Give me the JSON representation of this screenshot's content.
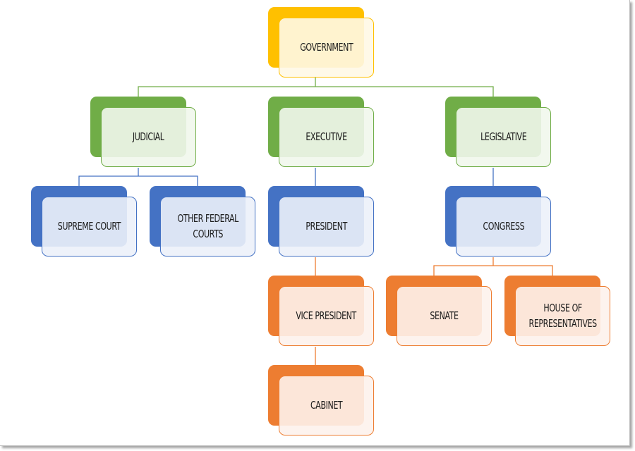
{
  "diagram": {
    "type": "org-chart",
    "colors": {
      "gold": "#FFC000",
      "gold_fill": "#FFF8E6",
      "green": "#70AD47",
      "green_fill": "#F1F7EC",
      "blue": "#4472C4",
      "blue_fill": "#ECF1FA",
      "orange": "#ED7D31",
      "orange_fill": "#FDF2EC"
    },
    "nodes": {
      "government": {
        "label": "Government",
        "color": "gold"
      },
      "judicial": {
        "label": "Judicial",
        "color": "green"
      },
      "executive": {
        "label": "Executive",
        "color": "green"
      },
      "legislative": {
        "label": "Legislative",
        "color": "green"
      },
      "supreme_court": {
        "label": "Supreme Court",
        "color": "blue"
      },
      "other_federal_courts": {
        "label": "Other Federal\nCourts",
        "color": "blue"
      },
      "president": {
        "label": "President",
        "color": "blue"
      },
      "congress": {
        "label": "Congress",
        "color": "blue"
      },
      "vice_president": {
        "label": "Vice President",
        "color": "orange"
      },
      "cabinet": {
        "label": "Cabinet",
        "color": "orange"
      },
      "senate": {
        "label": "Senate",
        "color": "orange"
      },
      "house_of_representatives": {
        "label": "House of\nRepresentatives",
        "color": "orange"
      }
    },
    "edges": [
      [
        "government",
        "judicial"
      ],
      [
        "government",
        "executive"
      ],
      [
        "government",
        "legislative"
      ],
      [
        "judicial",
        "supreme_court"
      ],
      [
        "judicial",
        "other_federal_courts"
      ],
      [
        "executive",
        "president"
      ],
      [
        "president",
        "vice_president"
      ],
      [
        "vice_president",
        "cabinet"
      ],
      [
        "legislative",
        "congress"
      ],
      [
        "congress",
        "senate"
      ],
      [
        "congress",
        "house_of_representatives"
      ]
    ]
  }
}
